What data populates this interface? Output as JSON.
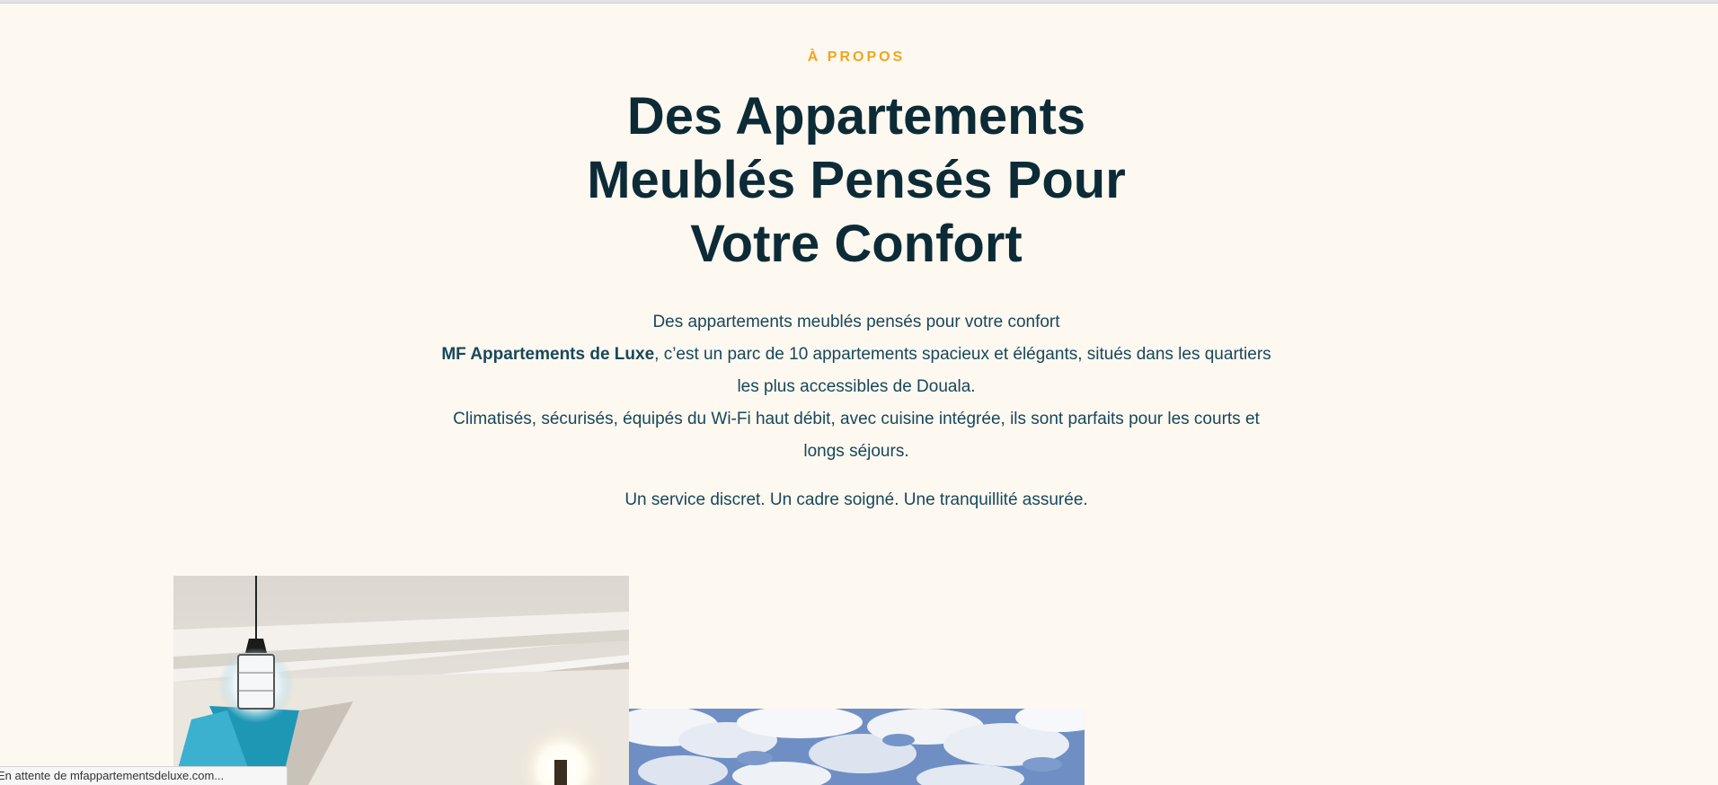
{
  "section": {
    "eyebrow": "À PROPOS",
    "title_lines": [
      "Des Appartements",
      "Meublés Pensés Pour",
      "Votre Confort"
    ],
    "intro": "Des appartements meublés pensés pour votre confort",
    "brand": "MF Appartements de Luxe",
    "paragraph1_rest": ", c’est un parc de 10 appartements spacieux et élégants, situés dans les quartiers",
    "paragraph1_cont": "les plus accessibles de Douala.",
    "paragraph2": "Climatisés, sécurisés, équipés du Wi-Fi haut débit, avec cuisine intégrée, ils sont parfaits pour les courts et",
    "paragraph2_cont": "longs séjours.",
    "tagline": "Un service discret. Un cadre soigné. Une tranquillité assurée."
  },
  "gallery": {
    "images": [
      {
        "subject": "apartment-interior-photo"
      },
      {
        "subject": "cloudy-sky-photo"
      }
    ]
  },
  "browser": {
    "status_text": "En attente de mfappartementsdeluxe.com..."
  },
  "colors": {
    "background": "#fdf8f0",
    "accent": "#f0a51e",
    "heading": "#0c2b36",
    "text": "#17485a"
  }
}
